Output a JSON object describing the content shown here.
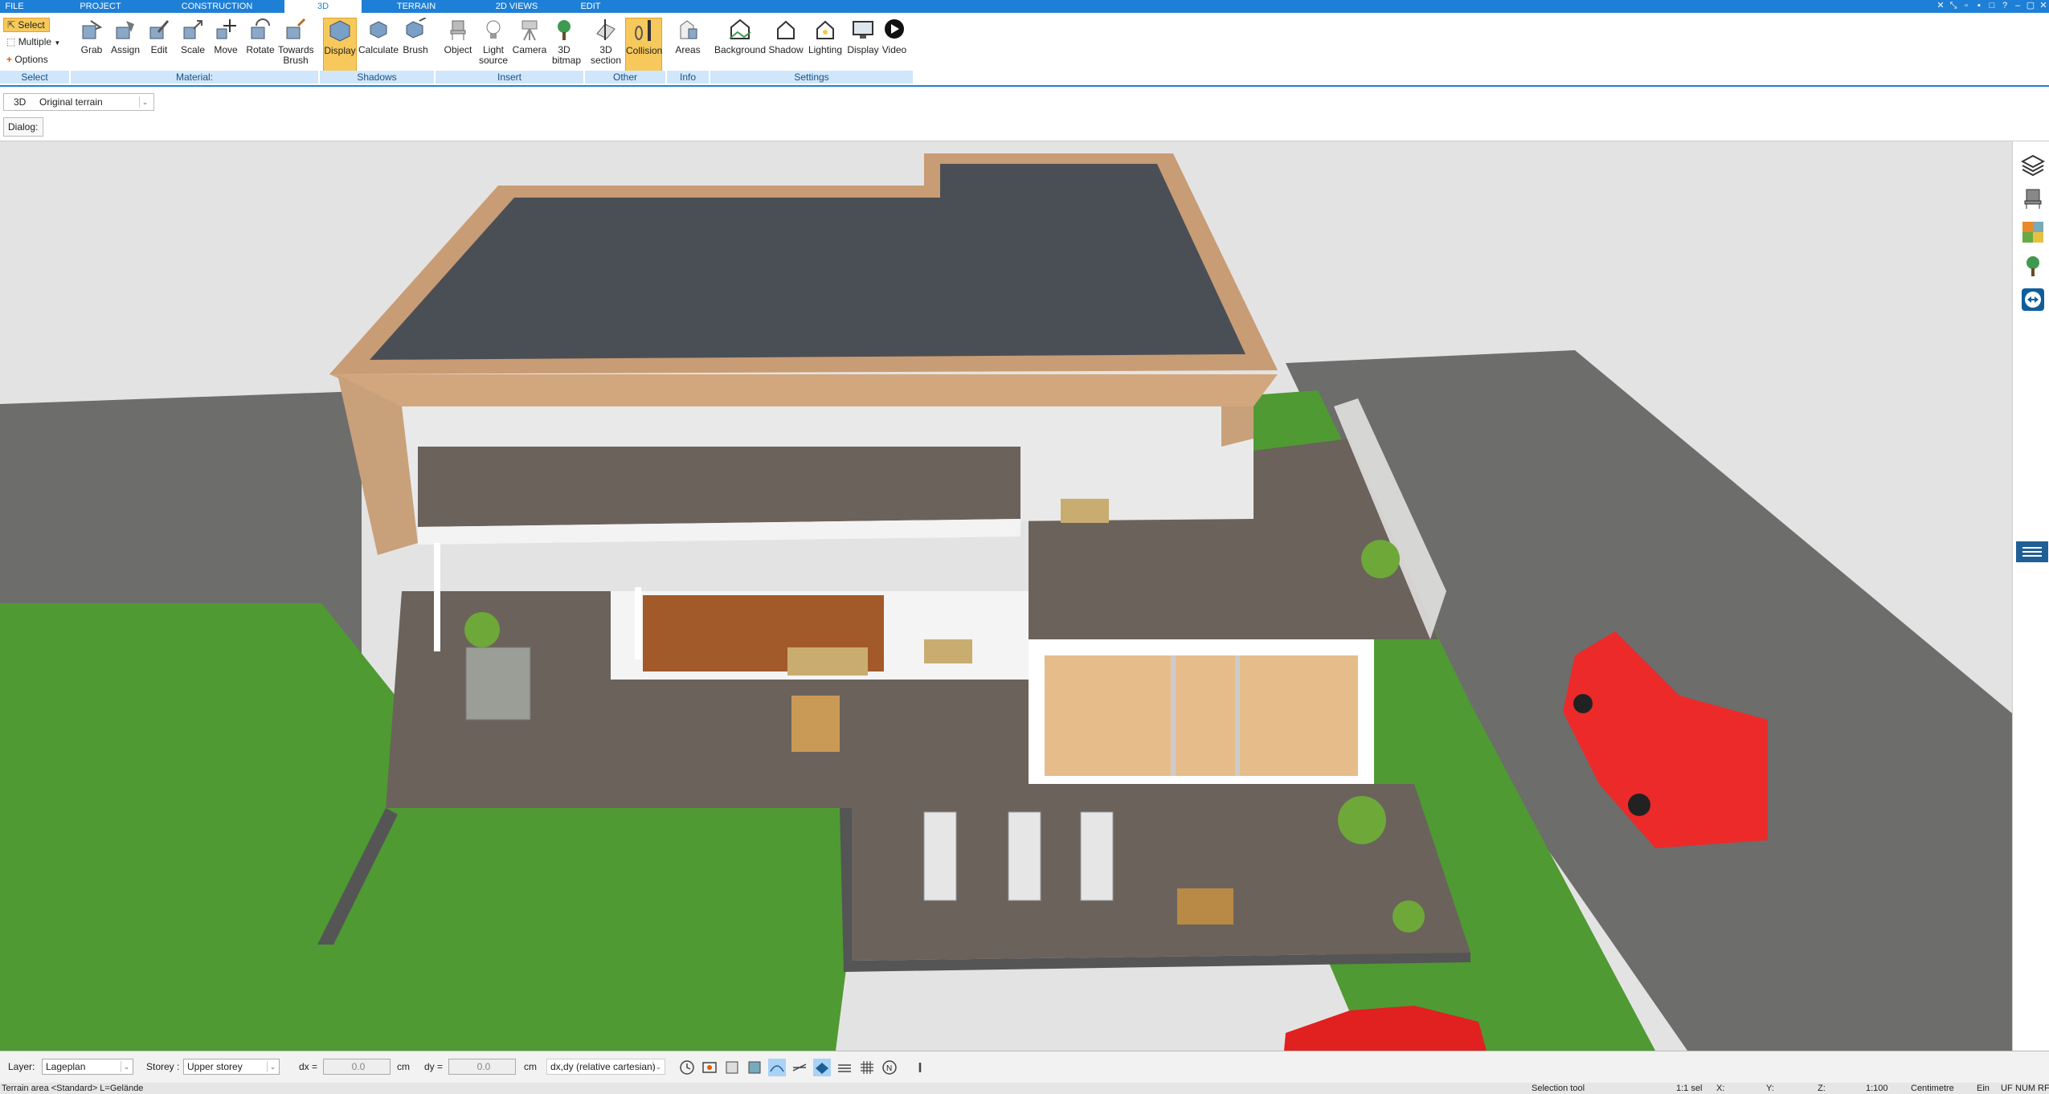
{
  "menu": {
    "tabs": [
      "FILE",
      "PROJECT",
      "CONSTRUCTION",
      "3D",
      "TERRAIN",
      "2D VIEWS",
      "EDIT"
    ],
    "active": "3D"
  },
  "ribbon": {
    "select": {
      "select": "Select",
      "multiple": "Multiple",
      "options": "Options"
    },
    "material_buttons": [
      "Grab",
      "Assign",
      "Edit",
      "Scale",
      "Move",
      "Rotate",
      "Towards Brush"
    ],
    "shadows_buttons": [
      "Display",
      "Calculate",
      "Brush"
    ],
    "insert_buttons": [
      "Object",
      "Light source",
      "Camera",
      "3D bitmap"
    ],
    "other_buttons": [
      "3D section",
      "Collision"
    ],
    "info_buttons": [
      "Areas"
    ],
    "settings_buttons": [
      "Background",
      "Shadow",
      "Lighting",
      "Display",
      "Video"
    ],
    "groups": {
      "select": "Select",
      "material": "Material:",
      "shadows": "Shadows",
      "insert": "Insert",
      "other": "Other",
      "info": "Info",
      "settings": "Settings"
    }
  },
  "viewbar": {
    "mode": "3D",
    "terrain": "Original terrain",
    "dialog_label": "Dialog:"
  },
  "statusbar": {
    "layer_label": "Layer:",
    "layer_value": "Lageplan",
    "storey_label": "Storey :",
    "storey_value": "Upper storey",
    "dx_label": "dx =",
    "dx_value": "0.0",
    "dx_unit": "cm",
    "dy_label": "dy =",
    "dy_value": "0.0",
    "dy_unit": "cm",
    "coord_mode": "dx,dy (relative cartesian)"
  },
  "infobar": {
    "left": "Terrain area <Standard> L=Gelände",
    "tool": "Selection tool",
    "sel": "1:1 sel",
    "x": "X:",
    "y": "Y:",
    "z": "Z:",
    "scale": "1:100",
    "unit": "Centimetre",
    "ein": "Ein",
    "uf": "UF",
    "num": "NUM",
    "rf": "RF"
  },
  "colors": {
    "accent": "#1e7fd6",
    "active_button": "#f7c95c",
    "group_bar": "#cfe6fb",
    "grass": "#4f9a33",
    "deck": "#6b625c",
    "asphalt": "#6d6d6b",
    "roof": "#4a4f55",
    "car": "#ec2a2a"
  }
}
